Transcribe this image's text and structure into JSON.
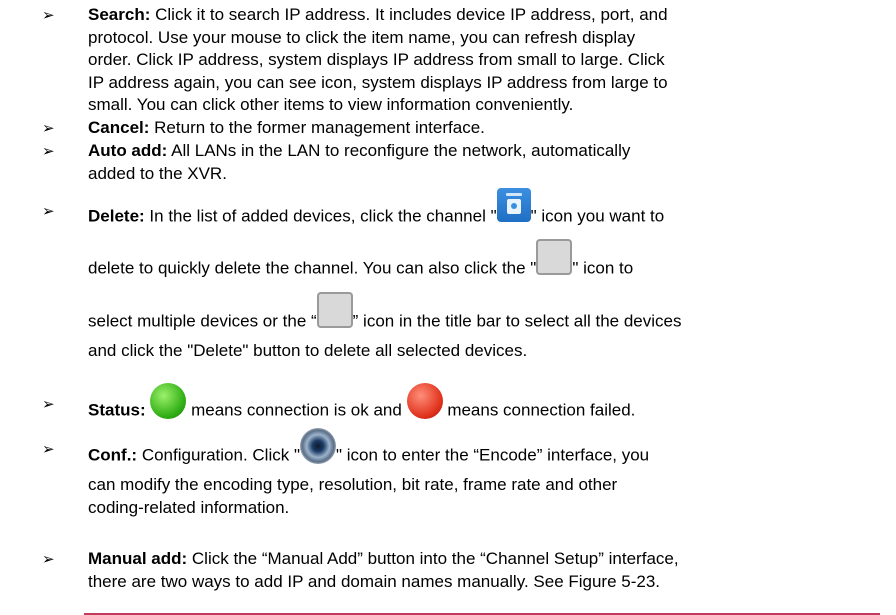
{
  "bullet_symbol": "➢",
  "items": [
    {
      "term": "Search:",
      "lines": [
        "Click it to search IP address. It includes device IP address, port, and",
        "protocol. Use your mouse to click the item name, you can refresh display",
        "order. Click IP address, system displays IP address from small to large. Click",
        "IP address again, you can see icon, system displays IP address from large to",
        "small. You can click other items to view information conveniently."
      ]
    },
    {
      "term": "Cancel:",
      "lines": [
        "Return to the former management interface."
      ]
    },
    {
      "term": "Auto add:",
      "lines": [
        "All LANs in the LAN to reconfigure the network, automatically",
        "added to the XVR."
      ]
    },
    {
      "term": "Delete:",
      "seg1a": "In the list of added devices, click the channel \"",
      "seg1b": "\" icon you want to",
      "seg2a": "delete to quickly delete the channel. You can also click the \"",
      "seg2b": "\" icon to",
      "seg3a": "select multiple devices or the “",
      "seg3b": "” icon in the title bar to select all the devices",
      "seg4": "and click the \"Delete\" button to delete all selected devices.",
      "icons": [
        "trash-icon",
        "checkbox-icon",
        "checkbox-icon"
      ]
    },
    {
      "term": "Status:",
      "seg_a": "means connection is ok and",
      "seg_b": "means connection failed.",
      "icons": [
        "green-status-icon",
        "red-status-icon"
      ],
      "colors": {
        "ok": "#2fae14",
        "failed": "#e0321c"
      }
    },
    {
      "term": "Conf.:",
      "seg1a": "Configuration. Click \"",
      "seg1b": "\" icon to enter the “Encode” interface, you",
      "lines": [
        "can modify the encoding type, resolution, bit rate, frame rate and other",
        "coding-related information."
      ],
      "icons": [
        "camera-icon"
      ]
    },
    {
      "term": "Manual add:",
      "lines": [
        "Click the “Manual Add” button into the “Channel Setup” interface,",
        "there are two ways to add IP and domain names manually. See Figure 5-23."
      ]
    }
  ]
}
